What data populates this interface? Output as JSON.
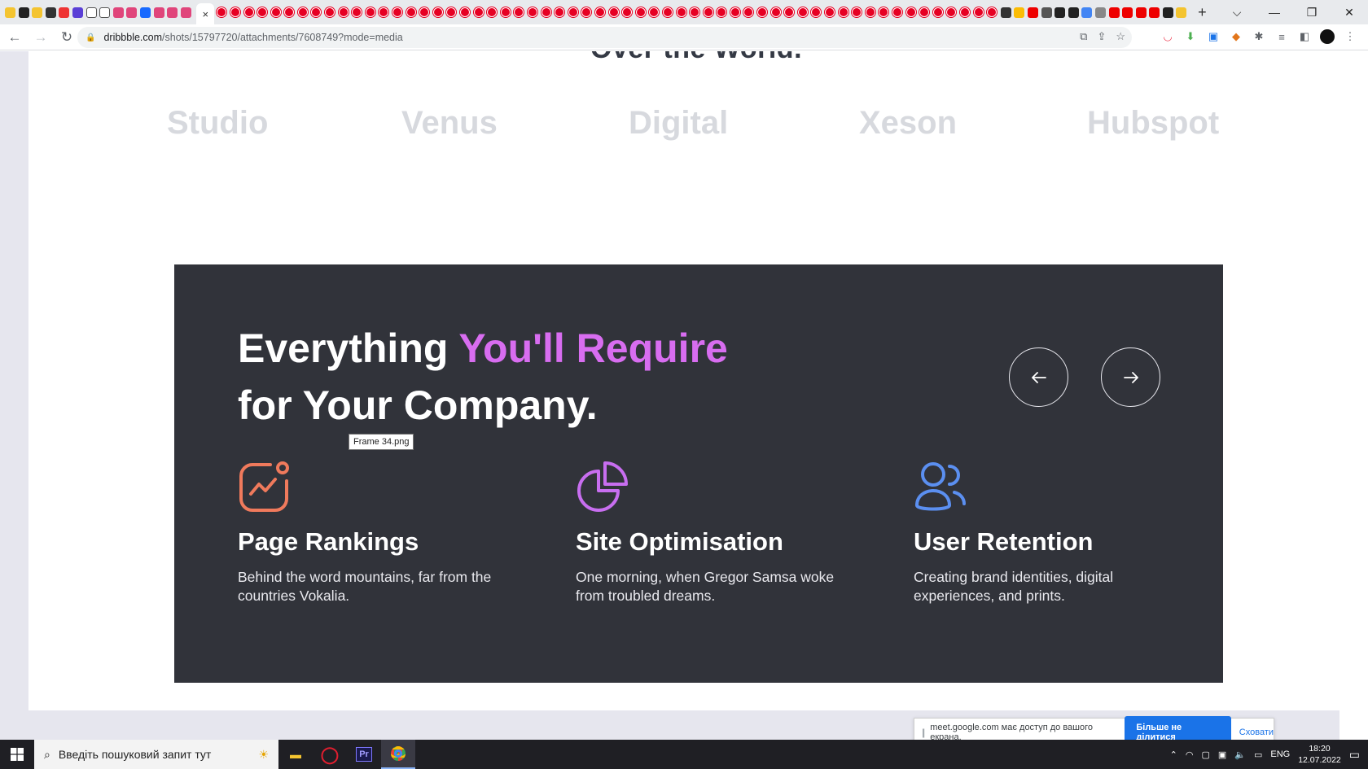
{
  "browser": {
    "active_tab_close": "×",
    "new_tab": "+",
    "url_host": "dribbble.com",
    "url_path": "/shots/15797720/attachments/7608749?mode=media",
    "window_controls": [
      "⌵",
      "—",
      "❐",
      "✕"
    ]
  },
  "page": {
    "cut_heading": "Over the World.",
    "logos": [
      "Studio",
      "Venus",
      "Digital",
      "Xeson",
      "Hubspot"
    ],
    "panel": {
      "headline_1a": "Everything ",
      "headline_1b": "You'll Require",
      "headline_2": "for Your Company.",
      "tooltip": "Frame 34.png",
      "features": [
        {
          "title": "Page Rankings",
          "text": "Behind the word mountains, far from the countries Vokalia.",
          "icon": "growth-chart-icon",
          "color": "#f07a5c"
        },
        {
          "title": "Site Optimisation",
          "text": "One morning, when Gregor Samsa woke from troubled dreams.",
          "icon": "pie-chart-icon",
          "color": "#c86ef0"
        },
        {
          "title": "User Retention",
          "text": "Creating brand identities, digital experiences, and prints.",
          "icon": "users-icon",
          "color": "#5b8ff0"
        }
      ]
    }
  },
  "share_bar": {
    "message": "meet.google.com має доступ до вашого екрана.",
    "stop_label": "Більше не ділитися",
    "hide_label": "Сховати"
  },
  "taskbar": {
    "search_placeholder": "Введіть пошуковий запит тут",
    "lang": "ENG",
    "time": "18:20",
    "date": "12.07.2022"
  },
  "colors": {
    "panel_bg": "#31333a",
    "accent": "#d86df0",
    "logo_gray": "#d7d9de"
  }
}
